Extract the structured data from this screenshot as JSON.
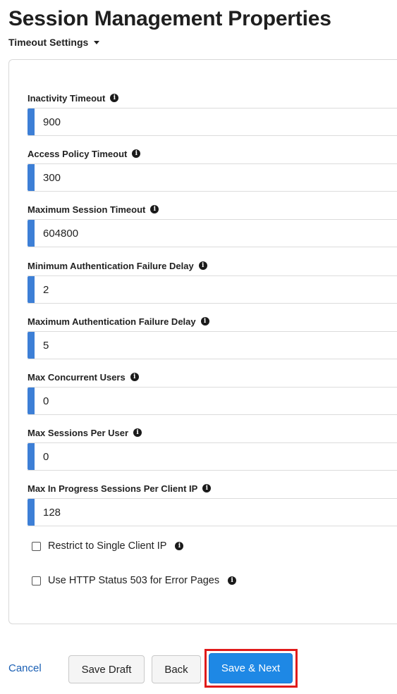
{
  "page": {
    "title": "Session Management Properties",
    "section_label": "Timeout Settings"
  },
  "fields": [
    {
      "label": "Inactivity Timeout",
      "value": "900"
    },
    {
      "label": "Access Policy Timeout",
      "value": "300"
    },
    {
      "label": "Maximum Session Timeout",
      "value": "604800"
    },
    {
      "label": "Minimum Authentication Failure Delay",
      "value": "2"
    },
    {
      "label": "Maximum Authentication Failure Delay",
      "value": "5"
    },
    {
      "label": "Max Concurrent Users",
      "value": "0"
    },
    {
      "label": "Max Sessions Per User",
      "value": "0"
    },
    {
      "label": "Max In Progress Sessions Per Client IP",
      "value": "128"
    }
  ],
  "checkboxes": [
    {
      "label": "Restrict to Single Client IP",
      "checked": false
    },
    {
      "label": "Use HTTP Status 503 for Error Pages",
      "checked": false
    }
  ],
  "footer": {
    "cancel_label": "Cancel",
    "save_draft_label": "Save Draft",
    "back_label": "Back",
    "save_next_label": "Save & Next"
  },
  "colors": {
    "accent": "#3d7fd6",
    "primary_button": "#1e88e5",
    "link": "#1a5fb4",
    "highlight": "#e01b1b"
  },
  "icons": {
    "info": "info-icon",
    "caret": "caret-down-icon"
  }
}
